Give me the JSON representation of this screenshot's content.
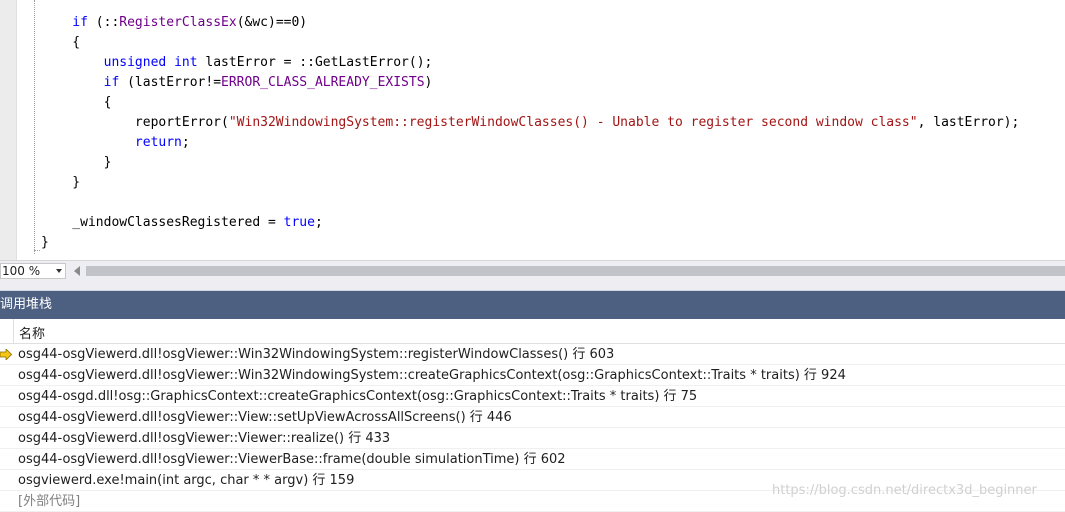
{
  "editor": {
    "lines": [
      [
        [
          "    if ",
          "kw"
        ],
        [
          "(::",
          "plain"
        ],
        [
          "RegisterClassEx",
          "fn"
        ],
        [
          "(&wc)==0)",
          "plain"
        ]
      ],
      [
        [
          "    {",
          "plain"
        ]
      ],
      [
        [
          "        ",
          "plain"
        ],
        [
          "unsigned",
          "kw"
        ],
        [
          " ",
          "plain"
        ],
        [
          "int",
          "kw"
        ],
        [
          " lastError = ::GetLastError();",
          "plain"
        ]
      ],
      [
        [
          "        ",
          "plain"
        ],
        [
          "if",
          "kw"
        ],
        [
          " (lastError!=",
          "plain"
        ],
        [
          "ERROR_CLASS_ALREADY_EXISTS",
          "macro"
        ],
        [
          ")",
          "plain"
        ]
      ],
      [
        [
          "        {",
          "plain"
        ]
      ],
      [
        [
          "            reportError(",
          "plain"
        ],
        [
          "\"Win32WindowingSystem::registerWindowClasses() - Unable to register second window class\"",
          "str"
        ],
        [
          ", lastError);",
          "plain"
        ]
      ],
      [
        [
          "            ",
          "plain"
        ],
        [
          "return",
          "kw"
        ],
        [
          ";",
          "plain"
        ]
      ],
      [
        [
          "        }",
          "plain"
        ]
      ],
      [
        [
          "    }",
          "plain"
        ]
      ],
      [
        [
          "",
          "plain"
        ]
      ],
      [
        [
          "    _windowClassesRegistered = ",
          "plain"
        ],
        [
          "true",
          "kw"
        ],
        [
          ";",
          "plain"
        ]
      ],
      [
        [
          "}",
          "plain"
        ]
      ]
    ]
  },
  "zoom": {
    "value": "100 %"
  },
  "callstack": {
    "title": "调用堆栈",
    "column_name": "名称",
    "frames": [
      {
        "text": "osg44-osgViewerd.dll!osgViewer::Win32WindowingSystem::registerWindowClasses() 行 603",
        "current": true
      },
      {
        "text": "osg44-osgViewerd.dll!osgViewer::Win32WindowingSystem::createGraphicsContext(osg::GraphicsContext::Traits * traits) 行 924"
      },
      {
        "text": "osg44-osgd.dll!osg::GraphicsContext::createGraphicsContext(osg::GraphicsContext::Traits * traits) 行 75"
      },
      {
        "text": "osg44-osgViewerd.dll!osgViewer::View::setUpViewAcrossAllScreens() 行 446"
      },
      {
        "text": "osg44-osgViewerd.dll!osgViewer::Viewer::realize() 行 433"
      },
      {
        "text": "osg44-osgViewerd.dll!osgViewer::ViewerBase::frame(double simulationTime) 行 602"
      },
      {
        "text": "osgviewerd.exe!main(int argc, char * * argv) 行 159"
      },
      {
        "text": "[外部代码]",
        "external": true
      }
    ]
  },
  "watermark": "https://blog.csdn.net/directx3d_beginner",
  "colors": {
    "keyword": "#0000ff",
    "function": "#6f008a",
    "string": "#a31515",
    "title_bar": "#4d6082",
    "current_frame_arrow": "#f5c518"
  },
  "icons": {
    "current_frame": "yellow-arrow-icon"
  }
}
